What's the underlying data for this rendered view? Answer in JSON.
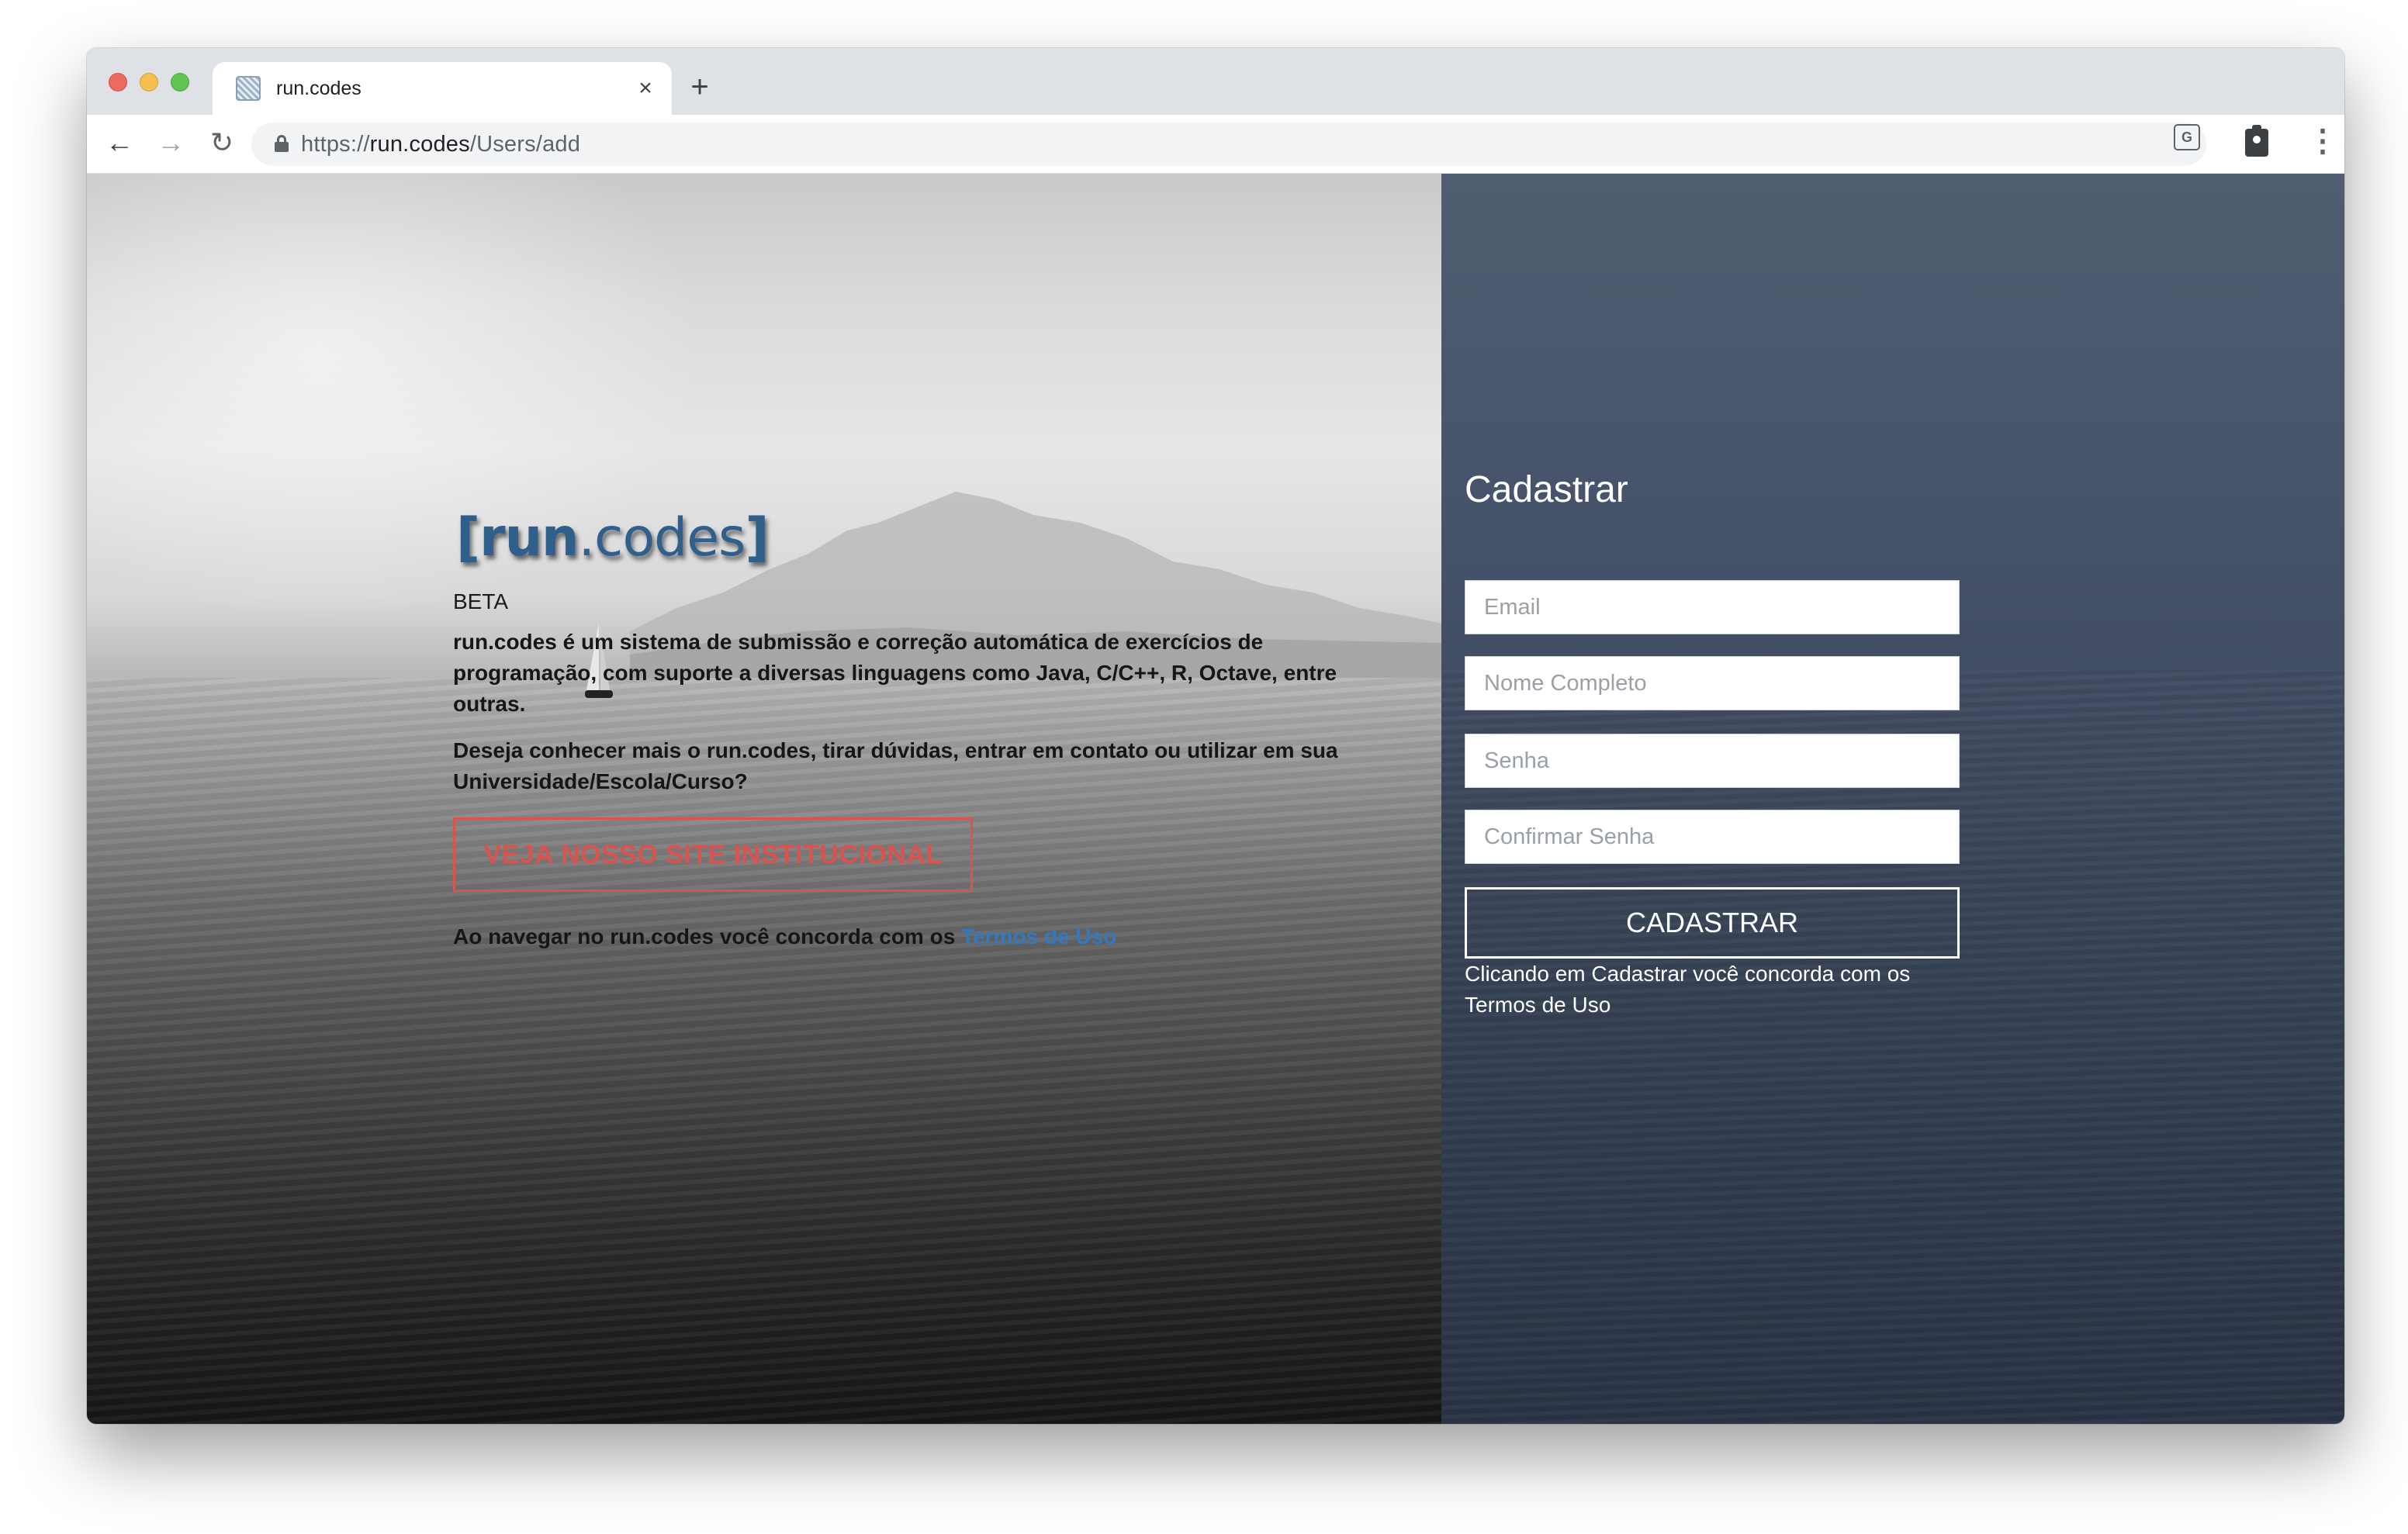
{
  "browser": {
    "tab_title": "run.codes",
    "tab_close": "×",
    "new_tab": "+",
    "back": "←",
    "forward": "→",
    "reload": "↻",
    "url_scheme": "https://",
    "url_host": "run.codes",
    "url_path": "/Users/add",
    "translate_glyph": "G",
    "menu_glyph": "⋮"
  },
  "hero": {
    "logo_bracket_open": "[",
    "logo_run": "run",
    "logo_dot_codes": ".codes",
    "logo_bracket_close": "]",
    "beta": "BETA",
    "description": "run.codes é um sistema de submissão e correção automática de exercícios de programação, com suporte a diversas linguagens como Java, C/C++, R, Octave, entre outras.",
    "question": "Deseja conhecer mais o run.codes, tirar dúvidas, entrar em contato ou utilizar em sua Universidade/Escola/Curso?",
    "cta_label": "VEJA NOSSO SITE INSTITUCIONAL",
    "terms_prefix": "Ao navegar no run.codes você concorda com os ",
    "terms_link": "Termos de Uso"
  },
  "signup": {
    "title": "Cadastrar",
    "email_placeholder": "Email",
    "name_placeholder": "Nome Completo",
    "password_placeholder": "Senha",
    "confirm_placeholder": "Confirmar Senha",
    "submit_label": "CADASTRAR",
    "note": "Clicando em Cadastrar você concorda com os Termos de Uso"
  },
  "colors": {
    "cta": "#d9534f",
    "link": "#3478c0",
    "logo": "#2f5f8a",
    "form_panel": "#3b4659"
  }
}
